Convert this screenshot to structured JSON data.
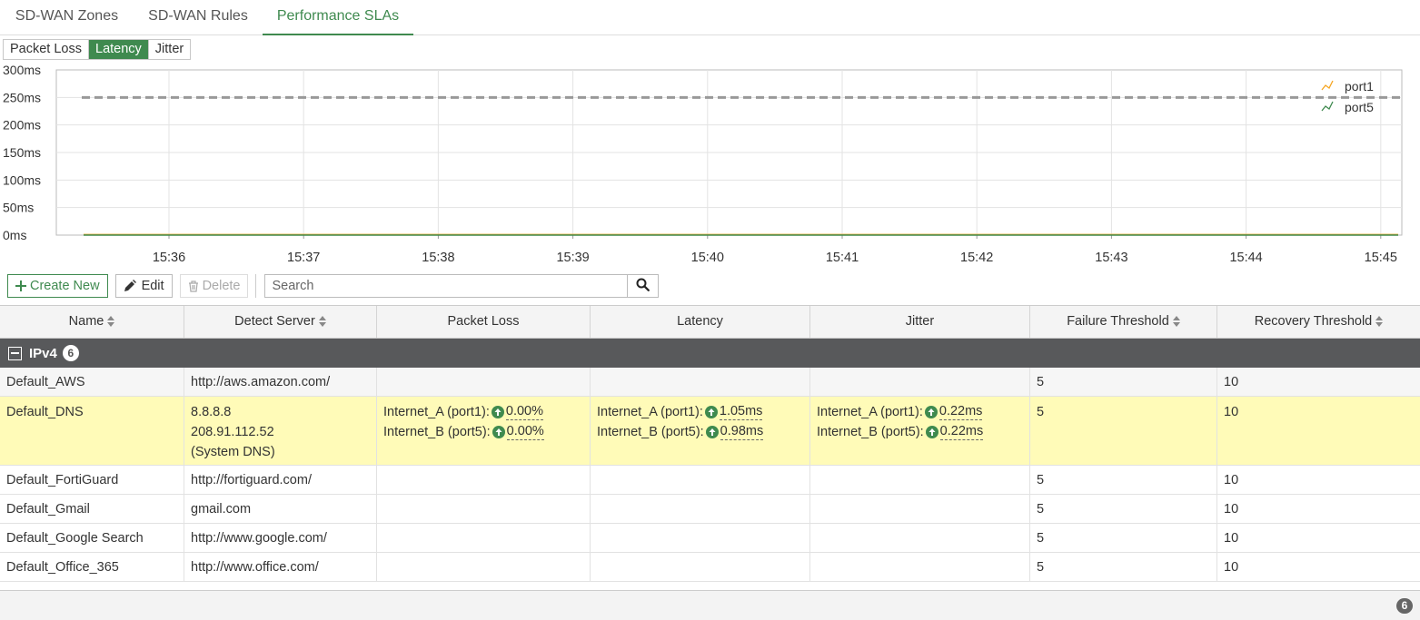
{
  "tabs": [
    {
      "label": "SD-WAN Zones"
    },
    {
      "label": "SD-WAN Rules"
    },
    {
      "label": "Performance SLAs"
    }
  ],
  "metric_tabs": [
    {
      "label": "Packet Loss"
    },
    {
      "label": "Latency"
    },
    {
      "label": "Jitter"
    }
  ],
  "colors": {
    "accent": "#3f8a4f",
    "port1": "#f5a623",
    "port5": "#3f8a4f",
    "group_bg": "#58595b",
    "selected_row": "#fffbb8"
  },
  "chart_data": {
    "type": "line",
    "x": [
      "15:36",
      "15:37",
      "15:38",
      "15:39",
      "15:40",
      "15:41",
      "15:42",
      "15:43",
      "15:44",
      "15:45"
    ],
    "y_ticks": [
      "0ms",
      "50ms",
      "100ms",
      "150ms",
      "200ms",
      "250ms",
      "300ms"
    ],
    "ylim": [
      0,
      300
    ],
    "threshold": 250,
    "series": [
      {
        "name": "port1",
        "values": [
          1,
          1,
          1,
          1,
          1,
          1,
          1,
          1,
          1,
          1
        ]
      },
      {
        "name": "port5",
        "values": [
          1,
          1,
          1,
          1,
          1,
          1,
          1,
          1,
          1,
          1
        ]
      }
    ],
    "grid": true,
    "legend_position": "top-right"
  },
  "toolbar": {
    "create_label": "Create New",
    "edit_label": "Edit",
    "delete_label": "Delete",
    "search_placeholder": "Search"
  },
  "table": {
    "headers": [
      "Name",
      "Detect Server",
      "Packet Loss",
      "Latency",
      "Jitter",
      "Failure Threshold",
      "Recovery Threshold"
    ],
    "group": {
      "label": "IPv4",
      "count": "6"
    },
    "rows": [
      {
        "name": "Default_AWS",
        "server": [
          "http://aws.amazon.com/"
        ],
        "failure": "5",
        "recovery": "10"
      },
      {
        "name": "Default_DNS",
        "server": [
          "8.8.8.8",
          "208.91.112.52",
          "(System DNS)"
        ],
        "failure": "5",
        "recovery": "10",
        "packet_loss": [
          {
            "label": "Internet_A (port1):",
            "value": "0.00%"
          },
          {
            "label": "Internet_B (port5):",
            "value": "0.00%"
          }
        ],
        "latency": [
          {
            "label": "Internet_A (port1):",
            "value": "1.05ms"
          },
          {
            "label": "Internet_B (port5):",
            "value": "0.98ms"
          }
        ],
        "jitter": [
          {
            "label": "Internet_A (port1):",
            "value": "0.22ms"
          },
          {
            "label": "Internet_B (port5):",
            "value": "0.22ms"
          }
        ]
      },
      {
        "name": "Default_FortiGuard",
        "server": [
          "http://fortiguard.com/"
        ],
        "failure": "5",
        "recovery": "10"
      },
      {
        "name": "Default_Gmail",
        "server": [
          "gmail.com"
        ],
        "failure": "5",
        "recovery": "10"
      },
      {
        "name": "Default_Google Search",
        "server": [
          "http://www.google.com/"
        ],
        "failure": "5",
        "recovery": "10"
      },
      {
        "name": "Default_Office_365",
        "server": [
          "http://www.office.com/"
        ],
        "failure": "5",
        "recovery": "10"
      }
    ]
  },
  "footer": {
    "count": "6"
  }
}
